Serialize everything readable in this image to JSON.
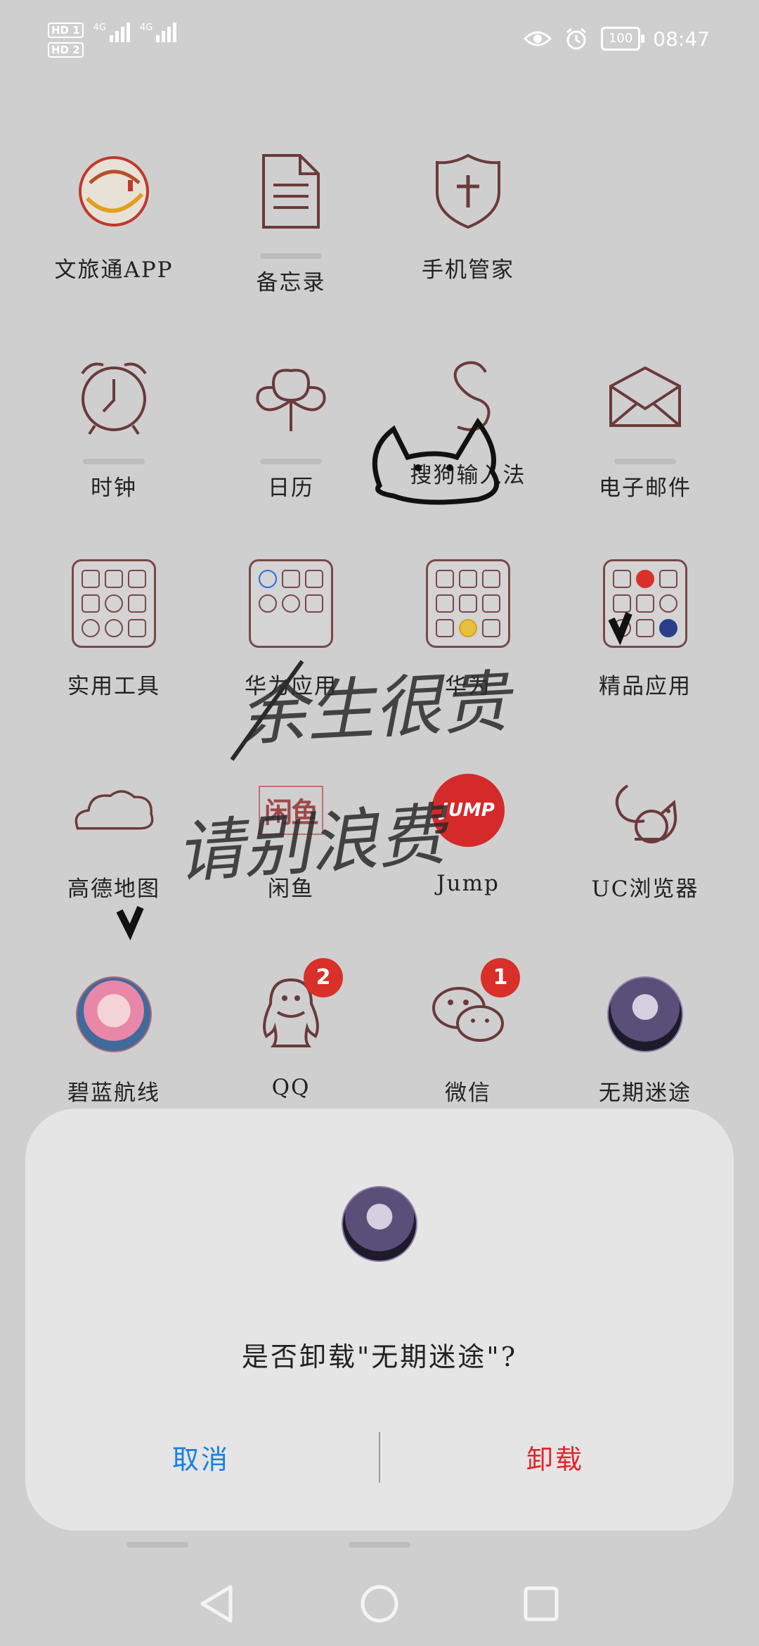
{
  "status_bar": {
    "sim1": "HD 1",
    "sim2": "HD 2",
    "net1": "4G",
    "net2": "4G",
    "battery": "100",
    "time": "08:47"
  },
  "apps": [
    {
      "label": "文旅通APP",
      "icon": "wenlvtong-icon"
    },
    {
      "label": "备忘录",
      "icon": "memo-icon"
    },
    {
      "label": "手机管家",
      "icon": "shield-icon"
    },
    {
      "label": "时钟",
      "icon": "clock-icon"
    },
    {
      "label": "日历",
      "icon": "calendar-clover-icon"
    },
    {
      "label": "搜狗输入法",
      "icon": "sogou-icon"
    },
    {
      "label": "电子邮件",
      "icon": "mail-icon"
    },
    {
      "label": "实用工具",
      "icon": "folder-icon"
    },
    {
      "label": "华为应用",
      "icon": "folder-icon"
    },
    {
      "label": "华为",
      "icon": "folder-icon"
    },
    {
      "label": "精品应用",
      "icon": "folder-icon"
    },
    {
      "label": "高德地图",
      "icon": "cloud-icon"
    },
    {
      "label": "闲鱼",
      "icon": "xianyu-icon"
    },
    {
      "label": "Jump",
      "icon": "jump-icon"
    },
    {
      "label": "UC浏览器",
      "icon": "squirrel-icon"
    },
    {
      "label": "碧蓝航线",
      "icon": "anime-avatar-icon"
    },
    {
      "label": "QQ",
      "icon": "penguin-icon",
      "badge": "2"
    },
    {
      "label": "微信",
      "icon": "wechat-icon",
      "badge": "1"
    },
    {
      "label": "无期迷途",
      "icon": "game-avatar-icon"
    }
  ],
  "dialog": {
    "question": "是否卸载\"无期迷途\"?",
    "cancel": "取消",
    "confirm": "卸载"
  },
  "doodle_text": {
    "line1": "余生很贵",
    "line2": "请别浪费"
  },
  "colors": {
    "accent_blue": "#1a7fe0",
    "danger_red": "#e0262d",
    "icon_stroke": "#7a4848"
  }
}
